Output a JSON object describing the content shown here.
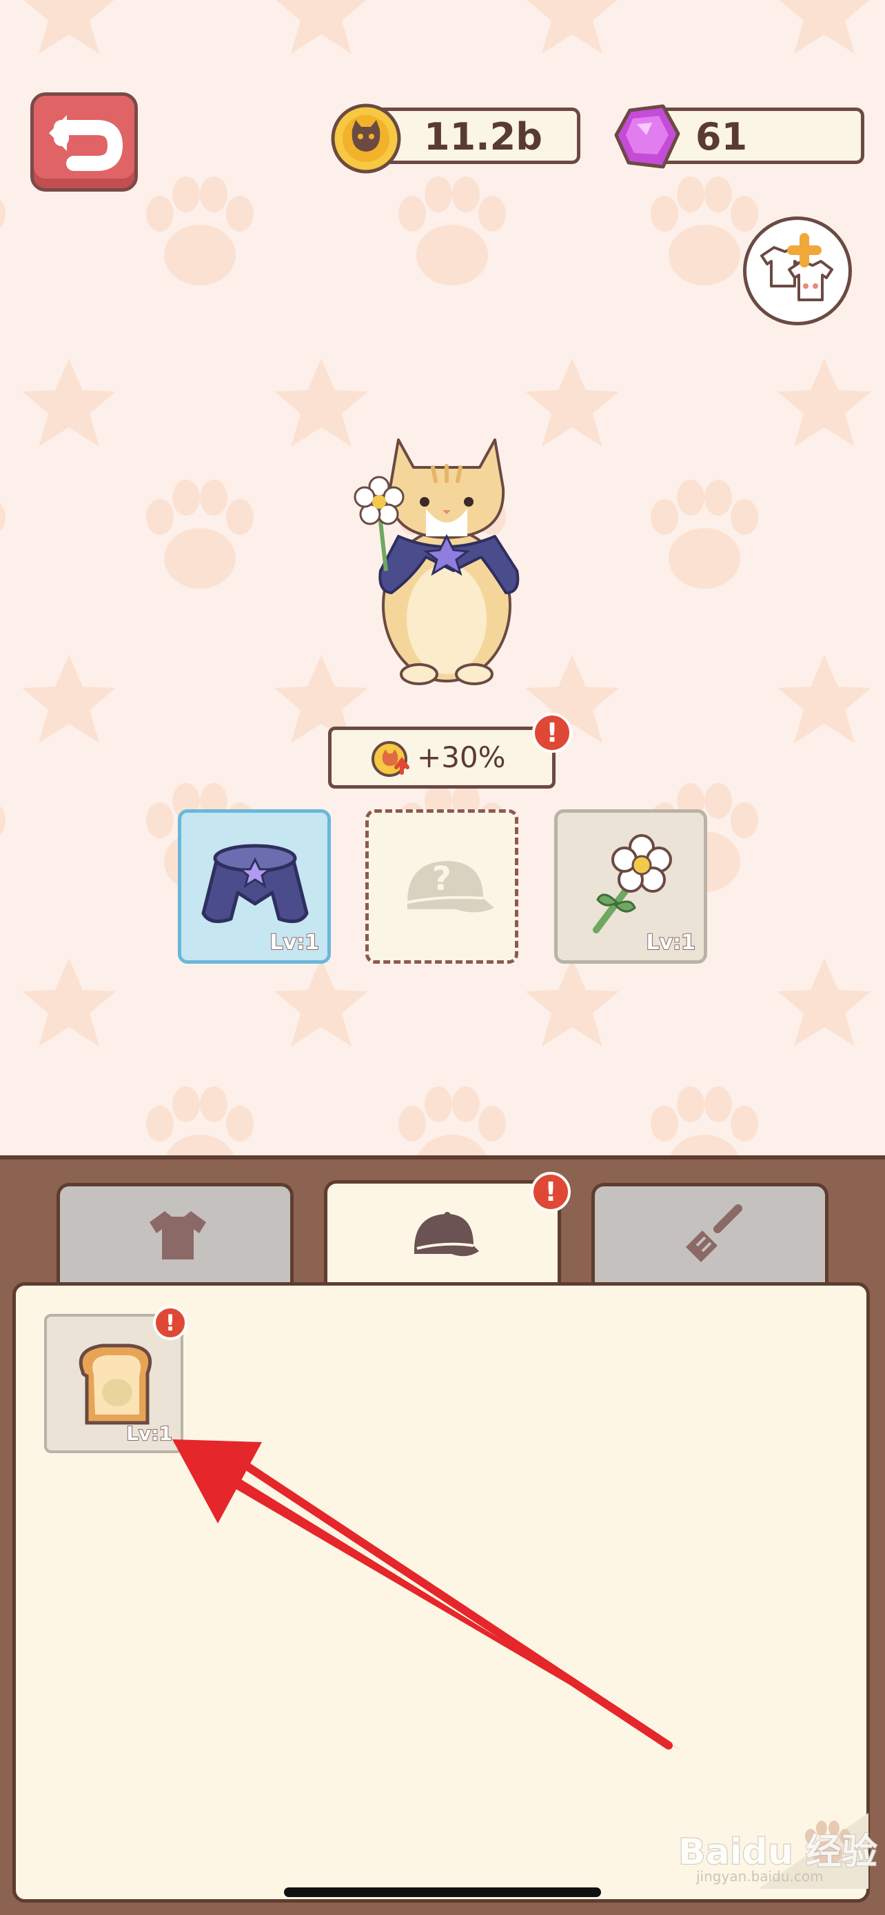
{
  "currency": {
    "coins": "11.2b",
    "gems": "61"
  },
  "bonus": {
    "text": "+30%",
    "alert": "!"
  },
  "equipped_slots": [
    {
      "name": "cape",
      "level": "Lv:1",
      "state": "selected"
    },
    {
      "name": "hat",
      "level": "",
      "state": "empty",
      "placeholder": "?"
    },
    {
      "name": "flower",
      "level": "Lv:1",
      "state": "filled"
    }
  ],
  "tabs": [
    {
      "name": "clothes",
      "icon": "shirt-icon",
      "active": false
    },
    {
      "name": "hats",
      "icon": "cap-icon",
      "active": true,
      "alert": "!"
    },
    {
      "name": "tools",
      "icon": "spatula-icon",
      "active": false
    }
  ],
  "inventory": [
    {
      "name": "toast",
      "icon": "bread-icon",
      "level": "Lv:1",
      "alert": "!"
    }
  ],
  "watermark": "Baidu 经验",
  "watermark_sub": "jingyan.baidu.com",
  "colors": {
    "accent_red": "#e06466",
    "selected_slot": "#c6e6f2",
    "panel_brown": "#8c6350",
    "alert_red": "#e04836"
  }
}
